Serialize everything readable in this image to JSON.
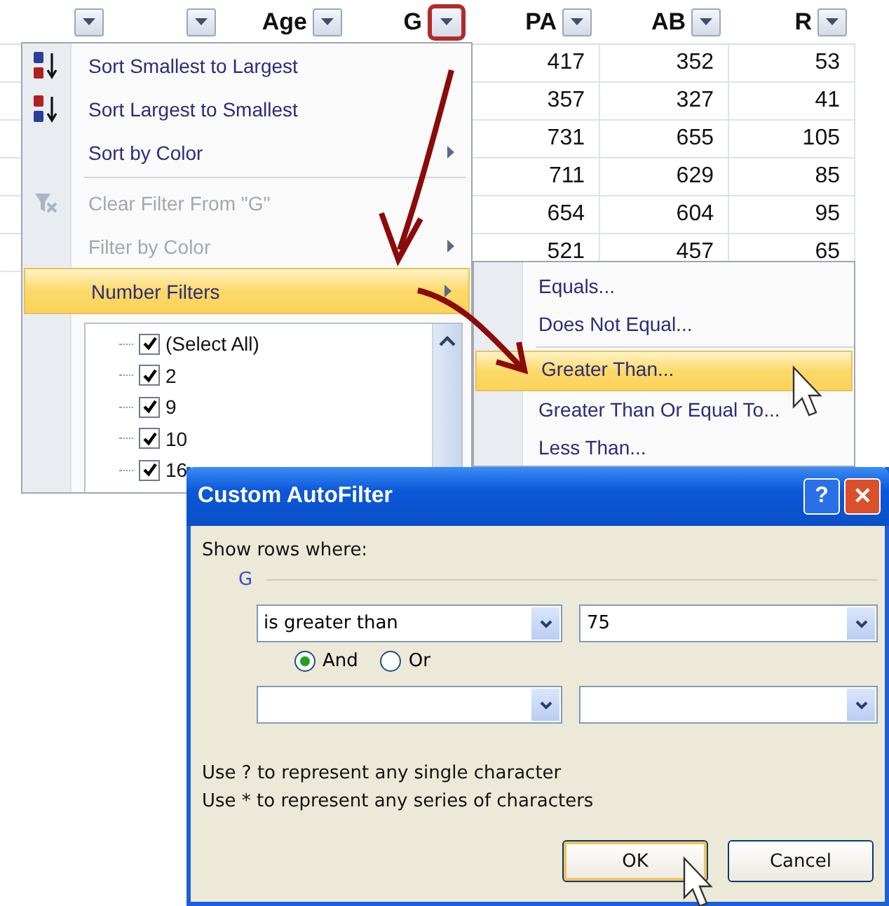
{
  "sheet": {
    "columns": [
      {
        "highlighted": false
      },
      {
        "highlighted": false
      },
      {
        "label": "Age",
        "highlighted": false
      },
      {
        "label": "G",
        "highlighted": true
      },
      {
        "label": "PA",
        "highlighted": false
      },
      {
        "label": "AB",
        "highlighted": false
      },
      {
        "label": "R",
        "highlighted": false
      }
    ],
    "rows": [
      [
        "417",
        "352",
        "53"
      ],
      [
        "357",
        "327",
        "41"
      ],
      [
        "731",
        "655",
        "105"
      ],
      [
        "711",
        "629",
        "85"
      ],
      [
        "654",
        "604",
        "95"
      ],
      [
        "521",
        "457",
        "65"
      ]
    ]
  },
  "filter_menu": {
    "items": [
      {
        "kind": "sort_up",
        "label": "Sort Smallest to Largest",
        "disabled": false,
        "submenu": false,
        "selected": false
      },
      {
        "kind": "sort_down",
        "label": "Sort Largest to Smallest",
        "disabled": false,
        "submenu": false,
        "selected": false
      },
      {
        "kind": "plain",
        "label": "Sort by Color",
        "disabled": false,
        "submenu": true,
        "selected": false
      },
      {
        "kind": "separator"
      },
      {
        "kind": "clear",
        "label": "Clear Filter From \"G\"",
        "disabled": true,
        "submenu": false,
        "selected": false
      },
      {
        "kind": "plain",
        "label": "Filter by Color",
        "disabled": true,
        "submenu": true,
        "selected": false
      },
      {
        "kind": "plain",
        "label": "Number Filters",
        "disabled": false,
        "submenu": true,
        "selected": true
      }
    ],
    "values": [
      {
        "label": "(Select All)",
        "checked": true
      },
      {
        "label": "2",
        "checked": true
      },
      {
        "label": "9",
        "checked": true
      },
      {
        "label": "10",
        "checked": true
      },
      {
        "label": "16",
        "checked": true
      }
    ]
  },
  "number_filters_menu": {
    "items": [
      {
        "kind": "item",
        "label": "Equals...",
        "selected": false
      },
      {
        "kind": "item",
        "label": "Does Not Equal...",
        "selected": false
      },
      {
        "kind": "separator"
      },
      {
        "kind": "item",
        "label": "Greater Than...",
        "selected": true
      },
      {
        "kind": "item",
        "label": "Greater Than Or Equal To...",
        "selected": false
      },
      {
        "kind": "item",
        "label": "Less Than...",
        "selected": false
      }
    ]
  },
  "dialog": {
    "title": "Custom AutoFilter",
    "help": "?",
    "close": "✕",
    "prompt": "Show rows where:",
    "field": "G",
    "criteria": [
      {
        "operator": "is greater than",
        "value": "75"
      }
    ],
    "join": [
      {
        "label": "And",
        "selected": true
      },
      {
        "label": "Or",
        "selected": false
      }
    ],
    "hints": [
      "Use ? to represent any single character",
      "Use * to represent any series of characters"
    ],
    "buttons": [
      {
        "label": "OK",
        "focused": true
      },
      {
        "label": "Cancel",
        "focused": false
      }
    ]
  }
}
